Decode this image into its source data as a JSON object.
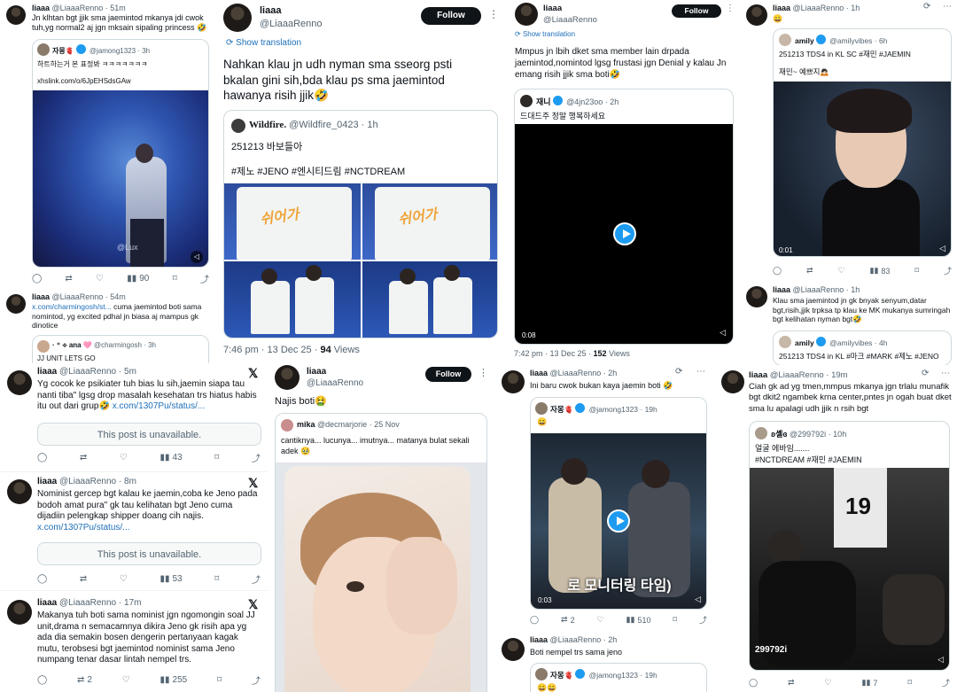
{
  "c1": {
    "t1": {
      "name": "liaaa",
      "handle": "@LiaaaRenno · 51m",
      "text": "Jn klhtan bgt jjik sma jaemintod mkanya jdi cwok tuh,yg normal2 aj jgn mksain sipaling princess 🤣",
      "q_name": "자몽🫀",
      "q_handle": "@jamong1323 · 3h",
      "q_text": "하트하는거 본 표정봐 ㅋㅋㅋㅋㅋㅋㅋ",
      "q_link": "xhslink.com/o/6JpEHSdsGAw",
      "watermark": "@Lux",
      "views": "90"
    },
    "t2": {
      "name": "liaaa",
      "handle": "@LiaaaRenno · 54m",
      "link": "x.com/charmingosh/st...",
      "text": " cuma jaemintod boti sama nomintod, yg excited pdhal jn biasa aj mampus gk dinotice",
      "q_name": "· ⁺ ⟡ ana 🩷",
      "q_handle": "@charmingosh · 3h",
      "q_text": "JJ UNIT LETS GO"
    },
    "t3": {
      "name": "liaaa",
      "handle": "@LiaaaRenno · 5m",
      "text": "Yg cocok ke psikiater tuh bias lu sih,jaemin siapa tau nanti tiba\" lgsg drop masalah kesehatan trs hiatus habis itu out dari grup🤣",
      "link": "x.com/1307Pu/status/...",
      "unavail": "This post is unavailable.",
      "views": "43"
    },
    "t4": {
      "name": "liaaa",
      "handle": "@LiaaaRenno · 8m",
      "text": "Nominist gercep bgt kalau ke jaemin,coba ke Jeno pada bodoh amat pura\" gk tau kelihatan bgt Jeno cuma dijadiin pelengkap shipper doang cih najis.",
      "link": "x.com/1307Pu/status/...",
      "unavail": "This post is unavailable.",
      "views": "53"
    },
    "t5": {
      "name": "liaaa",
      "handle": "@LiaaaRenno · 17m",
      "text": "Makanya tuh boti sama nominist jgn ngomongin soal JJ unit,drama n semacamnya dikira Jeno gk risih apa yg ada dia semakin bosen dengerin pertanyaan kagak mutu, terobsesi bgt jaemintod nominist sama Jeno numpang tenar dasar lintah nempel trs.",
      "replies": "2",
      "views": "255"
    }
  },
  "c2": {
    "t1": {
      "name": "liaaa",
      "handle": "@LiaaaRenno",
      "follow": "Follow",
      "translate": "Show translation",
      "text": "Nahkan klau jn udh nyman sma sseorg psti bkalan gini sih,bda klau ps sma jaemintod hawanya risih jjik🤣",
      "q_name": "Wildfire.",
      "q_handle": "@Wildfire_0423 · 1h",
      "q_line1": "251213 바보들아",
      "q_line2": "#제노 #JENO #엔시티드림 #NCTDREAM",
      "shirt_text": "쉬어가",
      "meta_time": "7:46 pm · 13 Dec 25 · ",
      "meta_views": "94",
      "meta_views_label": " Views"
    },
    "t2": {
      "name": "liaaa",
      "handle": "@LiaaaRenno",
      "follow": "Follow",
      "text": "Najis boti🤮",
      "q_name": "mika",
      "q_handle": "@decmarjorie · 25 Nov",
      "q_text": "cantiknya... lucunya... imutnya... matanya bulat sekali adek 🥹"
    }
  },
  "c3": {
    "t1": {
      "name": "liaaa",
      "handle": "@LiaaaRenno",
      "follow": "Follow",
      "translate": "Show translation",
      "text": "Mmpus jn lbih dket sma member lain drpada jaemintod,nomintod lgsg frustasi jgn Denial y kalau Jn emang risih jjik sma boti🤣",
      "q_name": "재니",
      "q_handle": "@4jn23oo · 2h",
      "q_text": "드대드주 정말 행복하세요",
      "time": "0:08",
      "meta_time": "7:42 pm · 13 Dec 25 · ",
      "meta_views": "152",
      "meta_views_label": " Views"
    },
    "t2": {
      "name": "liaaa",
      "handle": "@LiaaaRenno · 2h",
      "text": "Ini baru cwok bukan kaya jaemin boti 🤣",
      "q_name": "자몽🫀",
      "q_handle": "@jamong1323 · 19h",
      "q_emoji": "😀",
      "caption": "로 모니터링 타임)",
      "time": "0:03",
      "replies": "2",
      "views": "510"
    },
    "t3": {
      "name": "liaaa",
      "handle": "@LiaaaRenno · 2h",
      "text": "Boti nempel trs sama jeno",
      "q_name": "자몽🫀",
      "q_handle": "@jamong1323 · 19h",
      "q_emoji": "😀😀"
    }
  },
  "c4": {
    "t1": {
      "name": "liaaa",
      "handle": "@LiaaaRenno · 1h",
      "text": "😀",
      "q_name": "amily",
      "q_handle": "@amilyvibes · 6h",
      "q_line1": "251213 TDS4 in KL SC #재민 #JAEMIN",
      "q_line2": "재민~ 예쁘지🙇🏻",
      "time": "0:01",
      "views": "83"
    },
    "t2": {
      "name": "liaaa",
      "handle": "@LiaaaRenno · 1h",
      "text": "Klau sma jaemintod jn gk bnyak senyum,datar bgt,risih,jjik trpksa tp klau ke MK mukanya sumringah bgt kelihatan nyman bgt🤣",
      "q_name": "amily",
      "q_handle": "@amilyvibes · 4h",
      "q_text": "251213 TDS4 in KL #마크 #MARK #제노 #JENO"
    },
    "t3": {
      "name": "liaaa",
      "handle": "@LiaaaRenno · 19m",
      "text": "Ciah gk ad yg tmen,mmpus mkanya jgn trlalu munafik bgt dkit2 ngambek krna center,pntes jn ogah buat dket sma lu apalagi udh jjik n rsih bgt",
      "q_name": "ʚ셸ɞ",
      "q_handle": "@299792i · 10h",
      "q_line1": "얼굴 에바임.......",
      "q_line2": "#NCTDREAM #재민 #JAEMIN",
      "watermark": "299792i",
      "views": "7"
    }
  },
  "colors": {
    "accent": "#1d9bf0",
    "text": "#0f1419",
    "muted": "#536471",
    "link": "#1d6fb8",
    "border": "#cfd9de"
  },
  "icons": [
    "reply-icon",
    "retweet-icon",
    "like-icon",
    "views-icon",
    "bookmark-icon",
    "share-icon",
    "play-icon",
    "mute-icon",
    "x-logo-icon",
    "refresh-icon",
    "more-icon"
  ]
}
